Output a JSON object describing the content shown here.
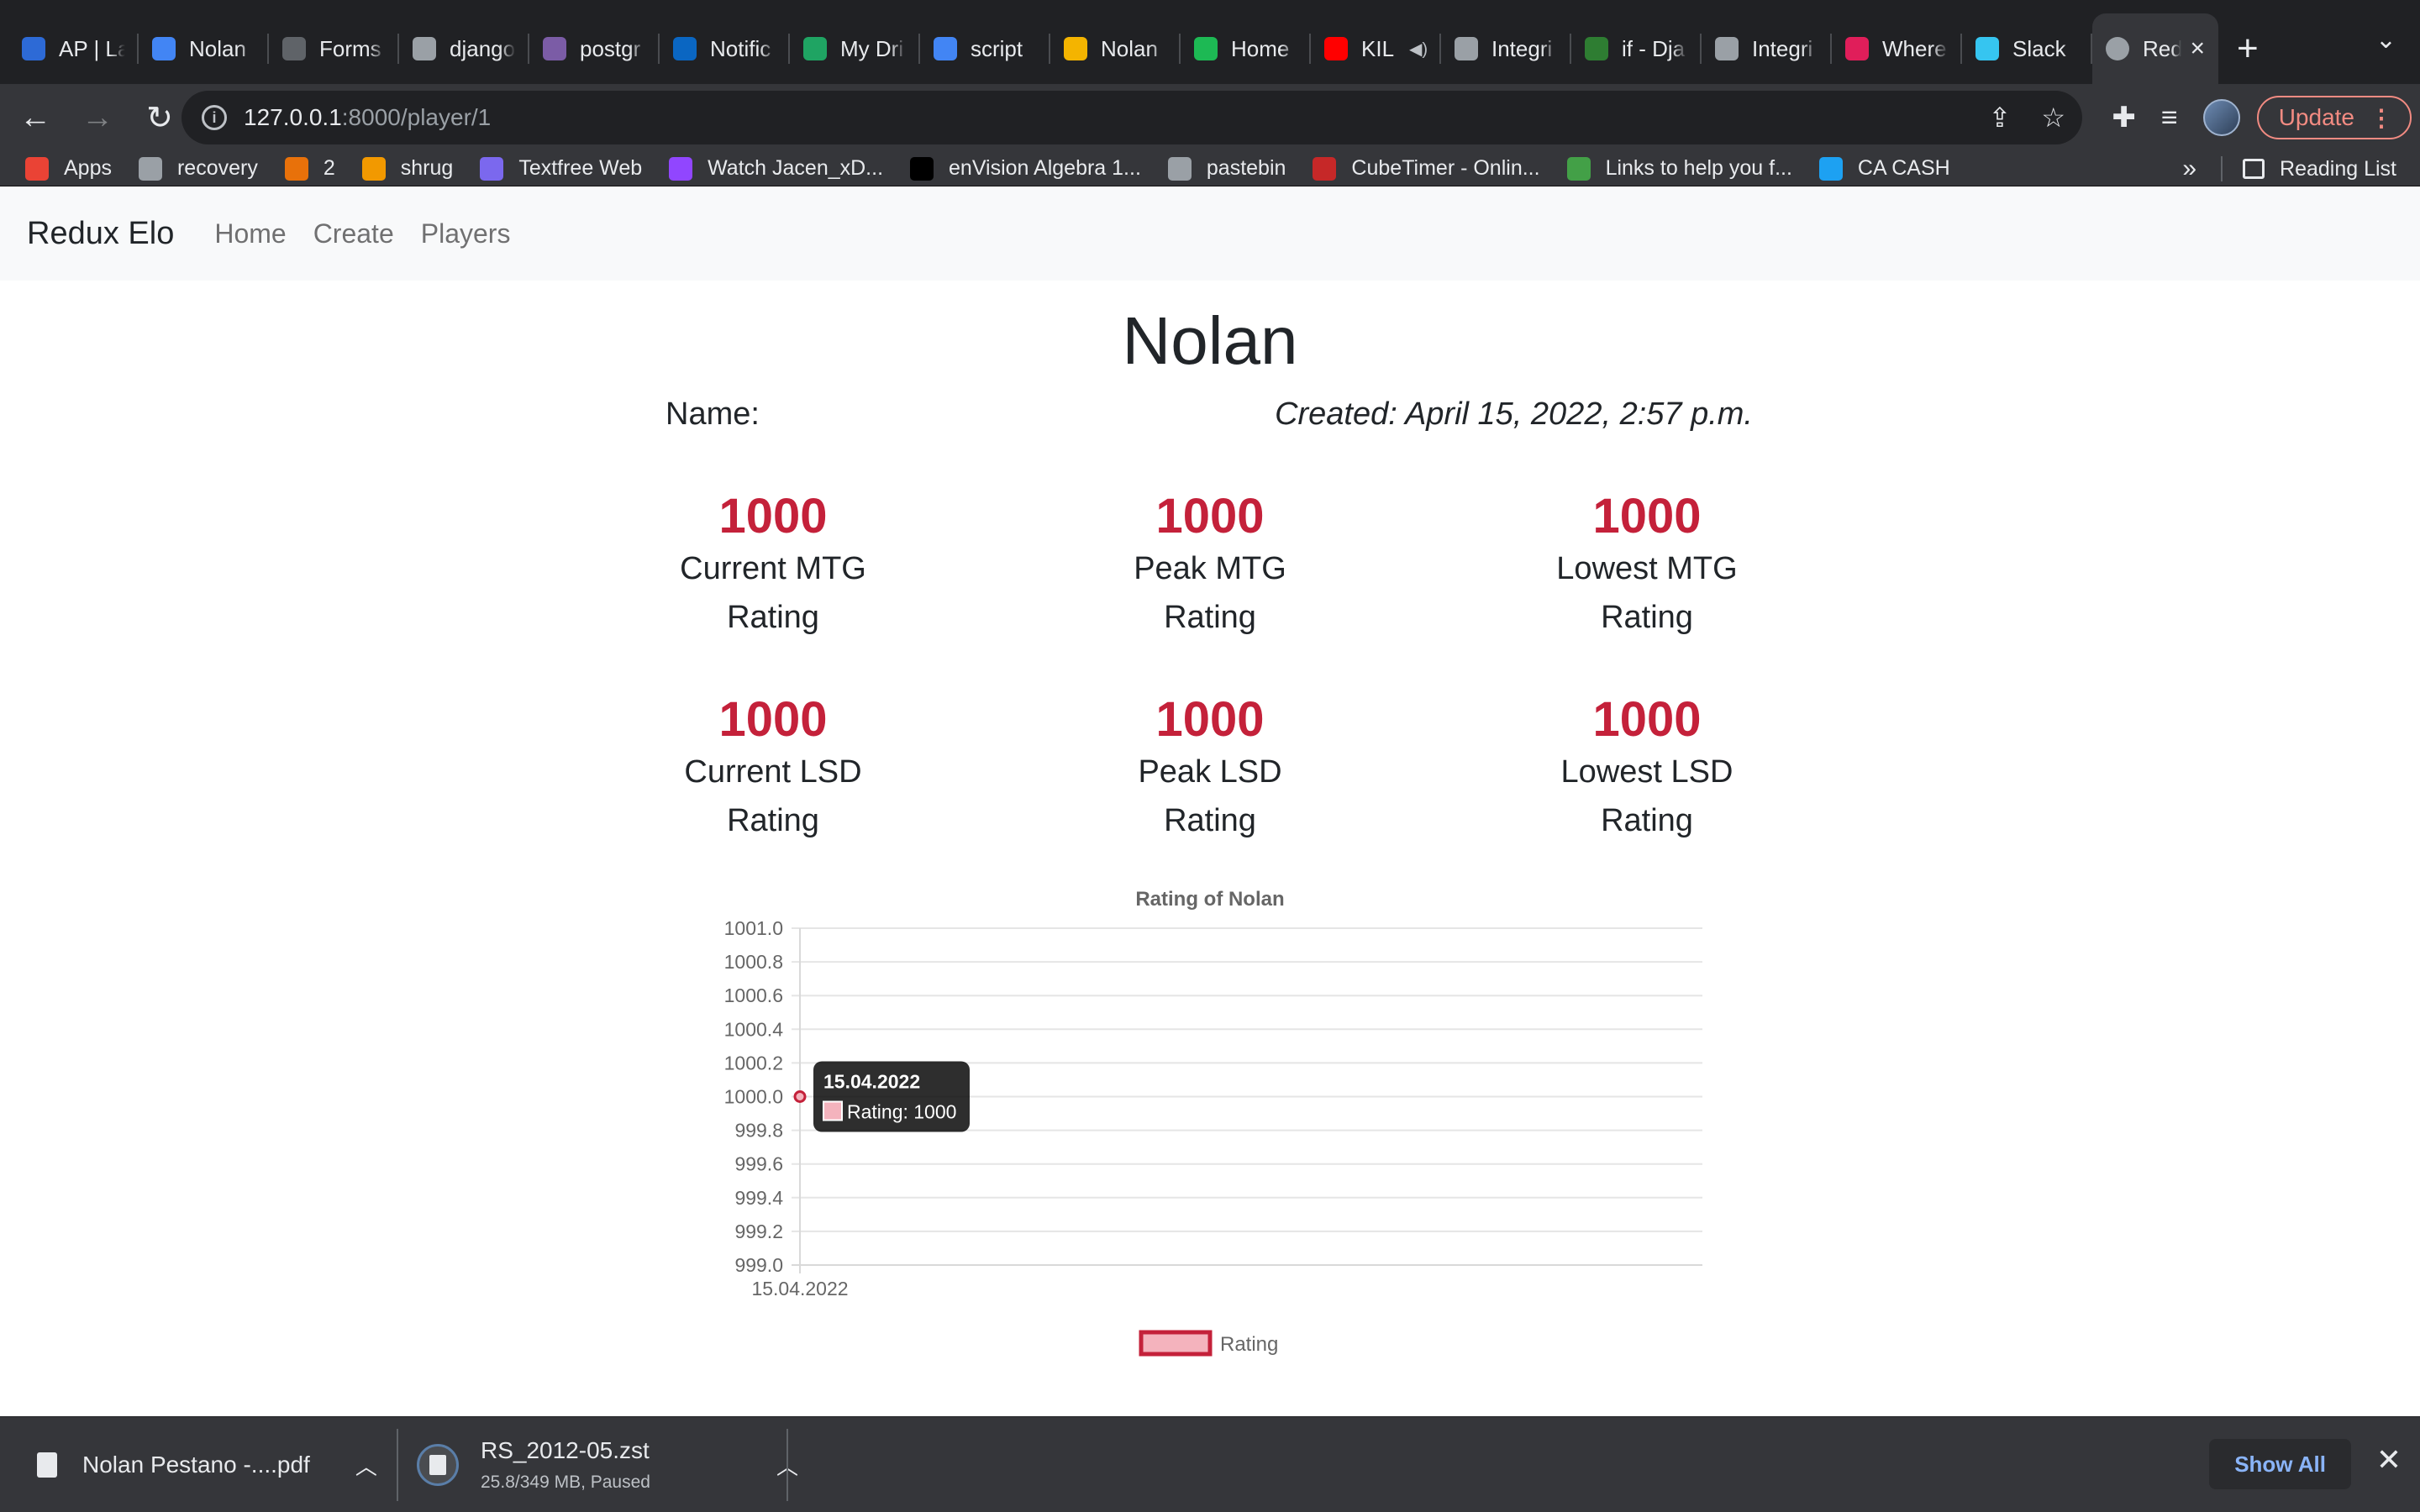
{
  "browser": {
    "tabs": [
      {
        "title": "AP | La",
        "icon": "shield-icon",
        "color": "#2d6ad6"
      },
      {
        "title": "Nolan",
        "icon": "docs-icon",
        "color": "#4285f4"
      },
      {
        "title": "Forms",
        "icon": "forms-icon",
        "color": "#5f6368"
      },
      {
        "title": "django",
        "icon": "bookmark-icon",
        "color": "#9aa0a6"
      },
      {
        "title": "postgr",
        "icon": "heroku-icon",
        "color": "#7b5ca6"
      },
      {
        "title": "Notific",
        "icon": "linkedin-icon",
        "color": "#0a66c2"
      },
      {
        "title": "My Dri",
        "icon": "drive-icon",
        "color": "#1fa463"
      },
      {
        "title": "script",
        "icon": "docs-icon",
        "color": "#4285f4"
      },
      {
        "title": "Nolan",
        "icon": "slides-icon",
        "color": "#f4b400"
      },
      {
        "title": "Home",
        "icon": "spotify-icon",
        "color": "#1db954"
      },
      {
        "title": "KIL",
        "icon": "youtube-icon",
        "color": "#ff0000",
        "muted": true
      },
      {
        "title": "Integri",
        "icon": "globe-icon",
        "color": "#9aa0a6"
      },
      {
        "title": "if - Dja",
        "icon": "link-icon",
        "color": "#2e7d32"
      },
      {
        "title": "Integri",
        "icon": "globe-icon",
        "color": "#9aa0a6"
      },
      {
        "title": "Where",
        "icon": "slack-icon",
        "color": "#e01e5a"
      },
      {
        "title": "Slack",
        "icon": "slack-icon",
        "color": "#36c5f0"
      }
    ],
    "active_tab": {
      "title": "Red",
      "icon": "globe-icon"
    },
    "url_host": "127.0.0.1",
    "url_rest": ":8000/player/1",
    "update_label": "Update",
    "bookmarks": [
      {
        "label": "Apps",
        "icon": "apps-grid-icon",
        "color": "#ea4335"
      },
      {
        "label": "recovery",
        "icon": "bookmark-icon",
        "color": "#9aa0a6"
      },
      {
        "label": "2",
        "icon": "bookmark-icon",
        "color": "#e8710a"
      },
      {
        "label": "shrug",
        "icon": "bookmark-icon",
        "color": "#f29900"
      },
      {
        "label": "Textfree Web",
        "icon": "chat-icon",
        "color": "#7b68ee"
      },
      {
        "label": "Watch Jacen_xD...",
        "icon": "twitch-icon",
        "color": "#9146ff"
      },
      {
        "label": "enVision Algebra 1...",
        "icon": "savvas-icon",
        "color": "#000000"
      },
      {
        "label": "pastebin",
        "icon": "folder-icon",
        "color": "#9aa0a6"
      },
      {
        "label": "CubeTimer - Onlin...",
        "icon": "bookmark-icon",
        "color": "#c62828"
      },
      {
        "label": "Links to help you f...",
        "icon": "bookmark-icon",
        "color": "#43a047"
      },
      {
        "label": "CA CASH",
        "icon": "twitter-icon",
        "color": "#1da1f2"
      }
    ],
    "reading_list_label": "Reading List"
  },
  "app": {
    "brand": "Redux Elo",
    "nav": [
      "Home",
      "Create",
      "Players"
    ]
  },
  "player": {
    "title": "Nolan",
    "name_label": "Name:",
    "created": "Created: April 15, 2022, 2:57 p.m.",
    "stats": [
      {
        "value": "1000",
        "label_line1": "Current MTG",
        "label_line2": "Rating"
      },
      {
        "value": "1000",
        "label_line1": "Peak MTG",
        "label_line2": "Rating"
      },
      {
        "value": "1000",
        "label_line1": "Lowest MTG",
        "label_line2": "Rating"
      },
      {
        "value": "1000",
        "label_line1": "Current LSD",
        "label_line2": "Rating"
      },
      {
        "value": "1000",
        "label_line1": "Peak LSD",
        "label_line2": "Rating"
      },
      {
        "value": "1000",
        "label_line1": "Lowest LSD",
        "label_line2": "Rating"
      }
    ]
  },
  "chart_data": {
    "type": "line",
    "title": "Rating of Nolan",
    "categories": [
      "15.04.2022"
    ],
    "series": [
      {
        "name": "Rating",
        "values": [
          1000
        ]
      }
    ],
    "ylim": [
      999.0,
      1001.0
    ],
    "yticks": [
      "1001.0",
      "1000.8",
      "1000.6",
      "1000.4",
      "1000.2",
      "1000.0",
      "999.8",
      "999.6",
      "999.4",
      "999.2",
      "999.0"
    ],
    "legend_position": "bottom",
    "grid": true,
    "line_color": "#c4213a",
    "fill_color": "#f4b3bd",
    "tooltip": {
      "title": "15.04.2022",
      "body": "Rating: 1000"
    }
  },
  "downloads": [
    {
      "name": "Nolan Pestano -....pdf",
      "status": ""
    },
    {
      "name": "RS_2012-05.zst",
      "status": "25.8/349 MB, Paused"
    }
  ],
  "show_all_label": "Show All"
}
